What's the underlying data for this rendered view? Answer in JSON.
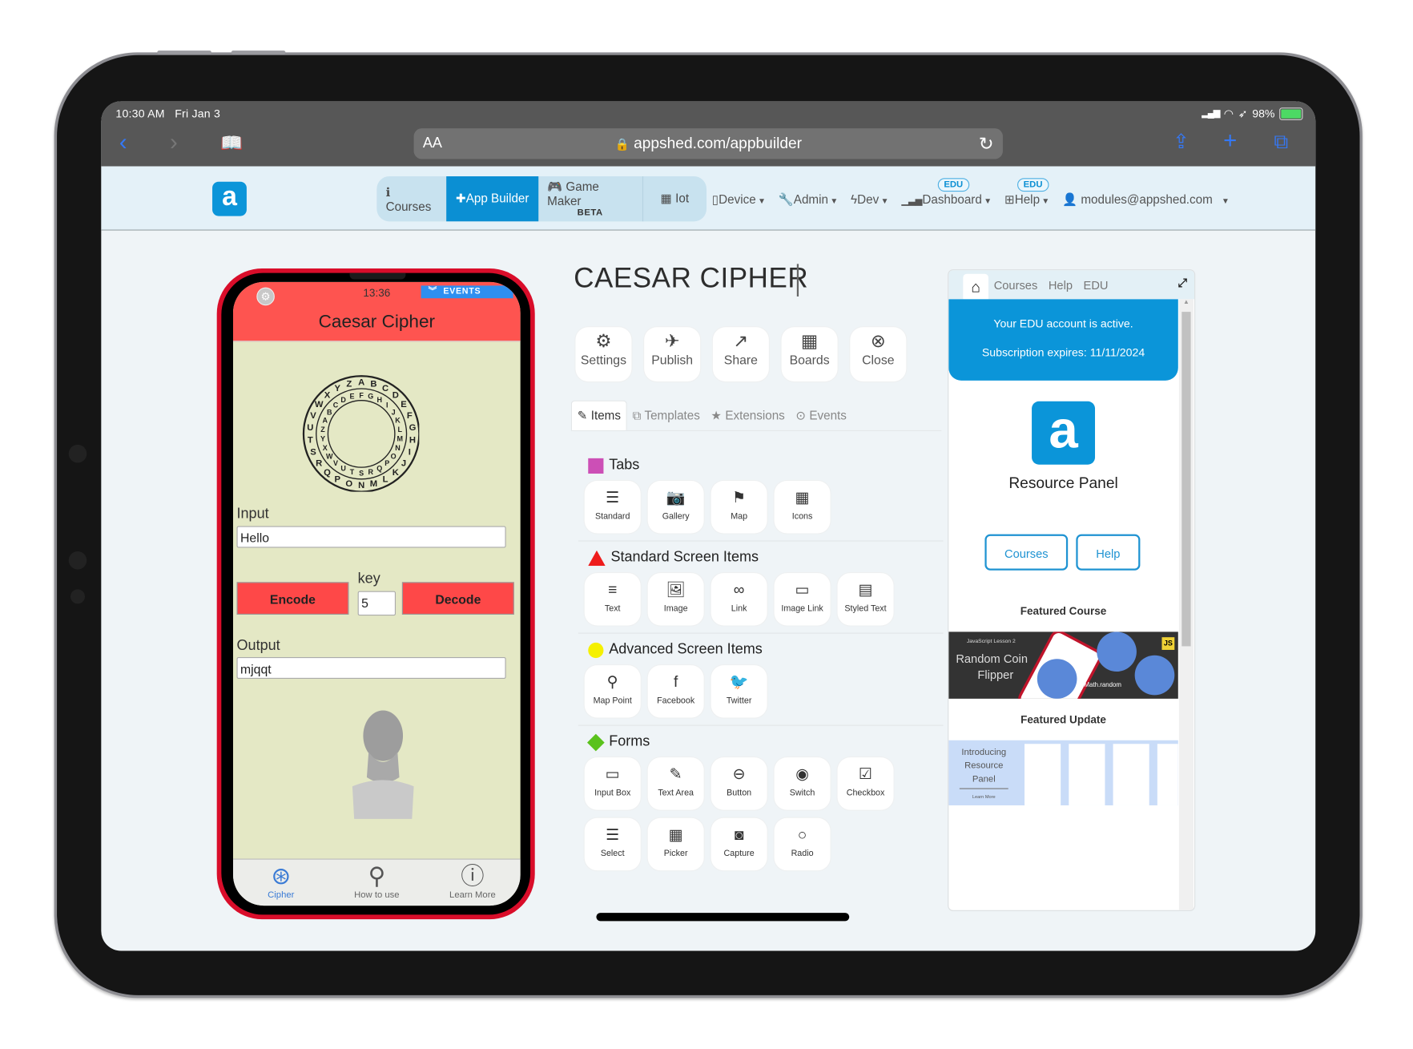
{
  "device": {
    "status_bar": {
      "time": "10:30 AM",
      "date": "Fri Jan 3",
      "battery": "98%",
      "battery_level": 0.98
    },
    "safari": {
      "text_size_label": "AA",
      "url": "appshed.com/appbuilder",
      "icons": [
        "back-icon",
        "forward-icon",
        "bookmarks-icon",
        "lock-icon",
        "reload-icon",
        "share-icon",
        "new-tab-icon",
        "tabs-icon"
      ]
    }
  },
  "app_nav": {
    "pills": [
      {
        "label": "Courses",
        "icon": "info-icon",
        "active": false
      },
      {
        "label": "App Builder",
        "icon": "plus-icon",
        "active": true
      },
      {
        "label": "Game Maker",
        "sub": "BETA",
        "icon": "gamepad-icon",
        "active": false
      },
      {
        "label": "Iot",
        "icon": "chip-icon",
        "active": false
      }
    ],
    "menus": [
      {
        "label": "Device",
        "icon": "phone-icon"
      },
      {
        "label": "Admin",
        "icon": "wrench-icon"
      },
      {
        "label": "Dev",
        "icon": "bolt-icon"
      },
      {
        "label": "Dashboard",
        "icon": "bar-chart-icon",
        "badge": "EDU"
      },
      {
        "label": "Help",
        "icon": "help-icon",
        "badge": "EDU"
      }
    ],
    "user": "modules@appshed.com"
  },
  "phone_preview": {
    "time": "13:36",
    "events_label": "EVENTS",
    "title": "Caesar Cipher",
    "input_label": "Input",
    "input_value": "Hello",
    "encode_label": "Encode",
    "key_label": "key",
    "key_value": "5",
    "decode_label": "Decode",
    "output_label": "Output",
    "output_value": "mjqqt",
    "tabs": [
      {
        "label": "Cipher",
        "active": true
      },
      {
        "label": "How to use",
        "active": false
      },
      {
        "label": "Learn More",
        "active": false
      }
    ]
  },
  "builder": {
    "app_title": "CAESAR CIPHER",
    "toolbar": [
      "Settings",
      "Publish",
      "Share",
      "Boards",
      "Close"
    ],
    "tabs": [
      {
        "label": "Items",
        "active": true
      },
      {
        "label": "Templates",
        "active": false
      },
      {
        "label": "Extensions",
        "active": false
      },
      {
        "label": "Events",
        "active": false
      }
    ],
    "sections": [
      {
        "title": "Tabs",
        "color": "#cc4fb6",
        "shape": "square",
        "items": [
          "Standard",
          "Gallery",
          "Map",
          "Icons"
        ]
      },
      {
        "title": "Standard Screen Items",
        "color": "#ee1c1c",
        "shape": "triangle",
        "items": [
          "Text",
          "Image",
          "Link",
          "Image Link",
          "Styled Text"
        ]
      },
      {
        "title": "Advanced Screen Items",
        "color": "#f5f000",
        "shape": "circle",
        "items": [
          "Map Point",
          "Facebook",
          "Twitter"
        ]
      },
      {
        "title": "Forms",
        "color": "#5ac21c",
        "shape": "diamond",
        "items": [
          "Input Box",
          "Text Area",
          "Button",
          "Switch",
          "Checkbox",
          "Select",
          "Picker",
          "Capture",
          "Radio"
        ]
      }
    ]
  },
  "resource_panel": {
    "tabs": [
      "Courses",
      "Help",
      "EDU"
    ],
    "notice_line1": "Your EDU account is active.",
    "notice_line2": "Subscription expires: 11/11/2024",
    "title": "Resource Panel",
    "buttons": [
      "Courses",
      "Help"
    ],
    "featured_course_label": "Featured Course",
    "featured_course": {
      "lesson": "JavaScript Lesson 2",
      "title_line1": "Random Coin",
      "title_line2": "Flipper",
      "tag": "Math.random",
      "badge": "JS"
    },
    "featured_update_label": "Featured Update",
    "featured_update": {
      "title_line1": "Introducing",
      "title_line2": "Resource",
      "title_line3": "Panel",
      "link": "Learn More"
    }
  }
}
